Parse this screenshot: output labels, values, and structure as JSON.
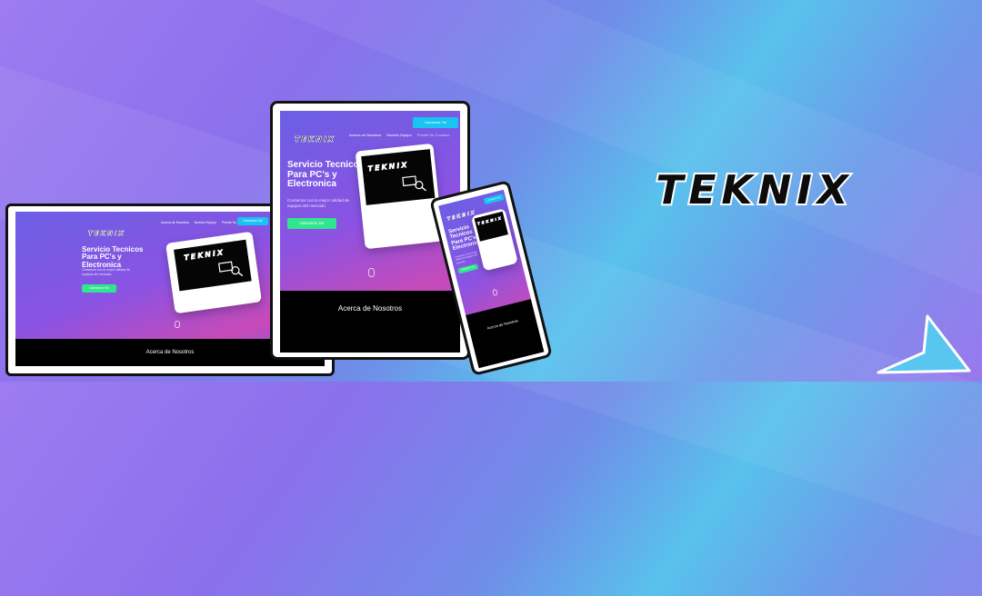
{
  "brand": {
    "name": "TEKNIX",
    "colors": {
      "accent_cyan": "#19c3f2",
      "accent_green": "#2fe58d",
      "footer_black": "#000000",
      "bg_purple": "#8b70ec",
      "bg_blue": "#58c2ec"
    }
  },
  "laptop": {
    "logo": "TEKNIX",
    "nav": [
      "Acerca de Nosotros",
      "Nuestro Equipo",
      "Pónete En Contacto"
    ],
    "call_button": "Llamanos Ya!",
    "hero_title": "Servicio Tecnicos Para PC's y Electronica",
    "hero_sub": "Contamos con la mejor calidad de equipos del mercado.",
    "cta_button": "Llamanos Ya!",
    "card_logo": "TEKNIX",
    "footer": "Acerca de Nosotros"
  },
  "tablet": {
    "logo": "TEKNIX",
    "call_button": "Llamanos Ya!",
    "nav": [
      "Acerca de Nosotros",
      "Nuestro Equipo",
      "Pónete En Contacto"
    ],
    "hero_title": "Servicio Tecnicos Para PC's y Electronica",
    "hero_sub": "Contamos con la mejor calidad de equipos del mercado.",
    "cta_button": "Llamanos Ya!",
    "card_logo": "TEKNIX",
    "footer": "Acerca de Nosotros"
  },
  "phone": {
    "logo": "TEKNIX",
    "call_button": "Llamanos Ya!",
    "hero_title": "Servicio Tecnicos Para PC's y Electronica",
    "hero_sub": "Contamos con la mejor calidad de equipos del mercado.",
    "cta_button": "Llamanos Ya!",
    "card_logo": "TEKNIX",
    "footer": "Acerca de Nosotros"
  },
  "hero_logo": "TEKNIX",
  "icons": [
    "monitor-search-icon",
    "mouse-scroll-icon",
    "arrow-cursor-icon"
  ]
}
